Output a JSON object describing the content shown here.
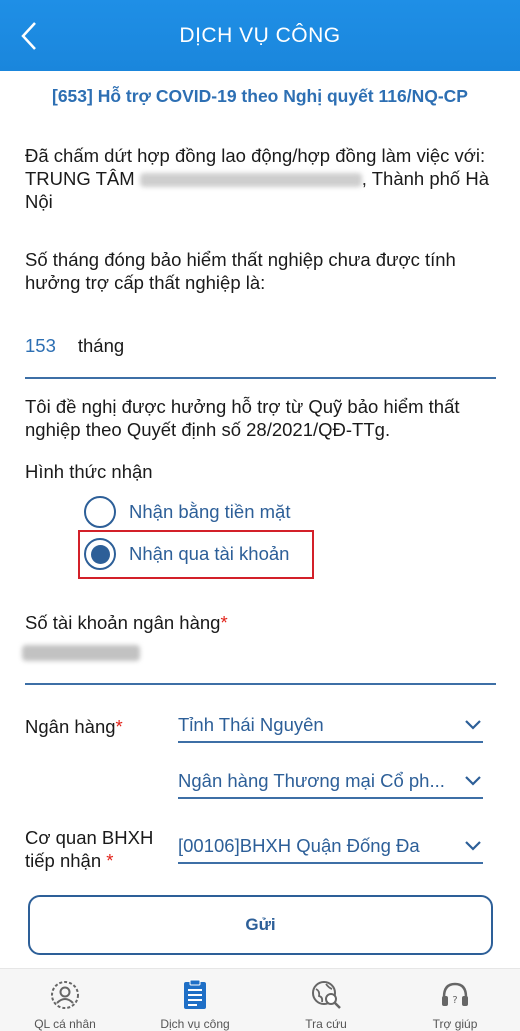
{
  "header": {
    "title": "DỊCH VỤ CÔNG"
  },
  "form": {
    "title": "[653] Hỗ trợ COVID-19 theo Nghị quyết 116/NQ-CP",
    "contract_prefix": "Đã chấm dứt hợp đồng  lao động/hợp đồng làm việc với: TRUNG TÂM",
    "contract_suffix": ", Thành phố Hà Nội",
    "months_question": "Số tháng đóng bảo hiểm thất nghiệp chưa được tính hưởng trợ cấp thất nghiệp là:",
    "months_value": "153",
    "months_unit": "tháng",
    "request_text": "Tôi đề nghị được hưởng hỗ trợ từ Quỹ bảo hiểm thất nghiệp theo Quyết định số 28/2021/QĐ-TTg.",
    "receive_method_label": "Hình thức nhận",
    "options": [
      {
        "label": "Nhận bằng tiền mặt",
        "selected": false
      },
      {
        "label": "Nhận qua tài khoản",
        "selected": true
      }
    ],
    "bank_account_label": "Số tài khoản ngân hàng",
    "required_mark": "*",
    "bank_label": "Ngân hàng",
    "bank_province": "Tỉnh Thái Nguyên",
    "bank_name": "Ngân hàng Thương mại Cổ ph...",
    "agency_label_line1": "Cơ quan BHXH",
    "agency_label_line2": "tiếp nhận",
    "agency_value": "[00106]BHXH Quận Đống Đa",
    "submit_label": "Gửi"
  },
  "nav": [
    {
      "label": "QL cá nhân",
      "icon": "person-icon"
    },
    {
      "label": "Dịch vụ công",
      "icon": "clipboard-icon"
    },
    {
      "label": "Tra cứu",
      "icon": "globe-search-icon"
    },
    {
      "label": "Trợ giúp",
      "icon": "headset-icon"
    }
  ],
  "colors": {
    "header": "#1f8fe6",
    "accent": "#2d5f98",
    "required": "#e2231a",
    "highlight": "#d32029"
  }
}
